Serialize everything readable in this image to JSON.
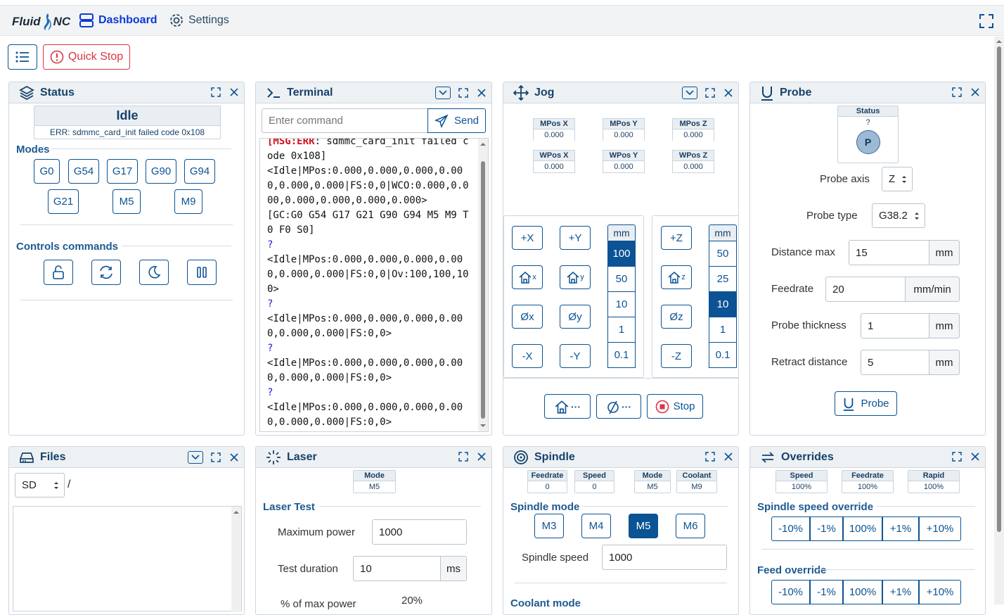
{
  "nav": {
    "brand_a": "Fluid",
    "brand_b": "NC",
    "dashboard": "Dashboard",
    "settings": "Settings"
  },
  "toolbar": {
    "quick_stop": "Quick Stop"
  },
  "status": {
    "title": "Status",
    "state": "Idle",
    "error": "ERR: sdmmc_card_init failed code 0x108",
    "modes_title": "Modes",
    "modes": [
      "G0",
      "G54",
      "G17",
      "G90",
      "G94",
      "G21",
      "M5",
      "M9"
    ],
    "controls_title": "Controls commands"
  },
  "terminal": {
    "title": "Terminal",
    "placeholder": "Enter command",
    "send": "Send",
    "lines": [
      {
        "t": "[MSG:ERR: sdmmc_card_init failed c",
        "c": "msg"
      },
      {
        "t": "ode 0x108]",
        "c": "n"
      },
      {
        "t": "<Idle|MPos:0.000,0.000,0.000,0.00",
        "c": "n"
      },
      {
        "t": "0,0.000,0.000|FS:0,0|WCO:0.000,0.0",
        "c": "n"
      },
      {
        "t": "00,0.000,0.000,0.000,0.000>",
        "c": "n"
      },
      {
        "t": "[GC:G0 G54 G17 G21 G90 G94 M5 M9 T",
        "c": "n"
      },
      {
        "t": "0 F0 S0]",
        "c": "n"
      },
      {
        "t": "?",
        "c": "q"
      },
      {
        "t": "<Idle|MPos:0.000,0.000,0.000,0.00",
        "c": "n"
      },
      {
        "t": "0,0.000,0.000|FS:0,0|Ov:100,100,10",
        "c": "n"
      },
      {
        "t": "0>",
        "c": "n"
      },
      {
        "t": "?",
        "c": "q"
      },
      {
        "t": "<Idle|MPos:0.000,0.000,0.000,0.00",
        "c": "n"
      },
      {
        "t": "0,0.000,0.000|FS:0,0>",
        "c": "n"
      },
      {
        "t": "?",
        "c": "q"
      },
      {
        "t": "<Idle|MPos:0.000,0.000,0.000,0.00",
        "c": "n"
      },
      {
        "t": "0,0.000,0.000|FS:0,0>",
        "c": "n"
      },
      {
        "t": "?",
        "c": "q"
      },
      {
        "t": "<Idle|MPos:0.000,0.000,0.000,0.00",
        "c": "n"
      },
      {
        "t": "0,0.000,0.000|FS:0,0>",
        "c": "n"
      }
    ]
  },
  "jog": {
    "title": "Jog",
    "pos": [
      {
        "h": "MPos X",
        "v": "0.000"
      },
      {
        "h": "MPos Y",
        "v": "0.000"
      },
      {
        "h": "MPos Z",
        "v": "0.000"
      },
      {
        "h": "WPos X",
        "v": "0.000"
      },
      {
        "h": "WPos Y",
        "v": "0.000"
      },
      {
        "h": "WPos Z",
        "v": "0.000"
      }
    ],
    "xy": {
      "px": "+X",
      "py": "+Y",
      "hx": "x",
      "hy": "y",
      "zx": "Øx",
      "zy": "Øy",
      "mx": "-X",
      "my": "-Y",
      "unit": "mm",
      "steps": [
        "100",
        "50",
        "10",
        "1",
        "0.1"
      ],
      "sel": 0
    },
    "z": {
      "pz": "+Z",
      "hz": "z",
      "zz": "Øz",
      "mz": "-Z",
      "unit": "mm",
      "steps": [
        "50",
        "25",
        "10",
        "1",
        "0.1"
      ],
      "sel": 2
    },
    "home_more": "···",
    "zero_more": "···",
    "stop": "Stop"
  },
  "probe": {
    "title": "Probe",
    "status_h": "Status",
    "status_v": "?",
    "led": "P",
    "axis_label": "Probe axis",
    "axis": "Z",
    "type_label": "Probe type",
    "type": "G38.2",
    "fields": [
      {
        "l": "Distance max",
        "v": "15",
        "u": "mm"
      },
      {
        "l": "Feedrate",
        "v": "20",
        "u": "mm/min"
      },
      {
        "l": "Probe thickness",
        "v": "1",
        "u": "mm"
      },
      {
        "l": "Retract distance",
        "v": "5",
        "u": "mm"
      }
    ],
    "button": "Probe"
  },
  "files": {
    "title": "Files",
    "drive": "SD",
    "path": "/"
  },
  "laser": {
    "title": "Laser",
    "mode_h": "Mode",
    "mode_v": "M5",
    "test_title": "Laser Test",
    "max_power_l": "Maximum power",
    "max_power": "1000",
    "duration_l": "Test duration",
    "duration": "10",
    "duration_u": "ms",
    "pct_l": "% of max power",
    "pct": "20%"
  },
  "spindle": {
    "title": "Spindle",
    "stats": [
      {
        "h": "Feedrate",
        "v": "0"
      },
      {
        "h": "Speed",
        "v": "0"
      },
      {
        "h": "Mode",
        "v": "M5"
      },
      {
        "h": "Coolant",
        "v": "M9"
      }
    ],
    "mode_title": "Spindle mode",
    "modes": [
      "M3",
      "M4",
      "M5",
      "M6"
    ],
    "sel": 2,
    "speed_l": "Spindle speed",
    "speed": "1000",
    "coolant_title": "Coolant mode"
  },
  "overrides": {
    "title": "Overrides",
    "stats": [
      {
        "h": "Speed",
        "v": "100%"
      },
      {
        "h": "Feedrate",
        "v": "100%"
      },
      {
        "h": "Rapid",
        "v": "100%"
      }
    ],
    "spindle_t": "Spindle speed override",
    "feed_t": "Feed override",
    "buttons": [
      "-10%",
      "-1%",
      "100%",
      "+1%",
      "+10%"
    ]
  },
  "colors": {
    "primary": "#0b5394",
    "danger": "#dc3545",
    "header_bg": "#edf1f4"
  }
}
